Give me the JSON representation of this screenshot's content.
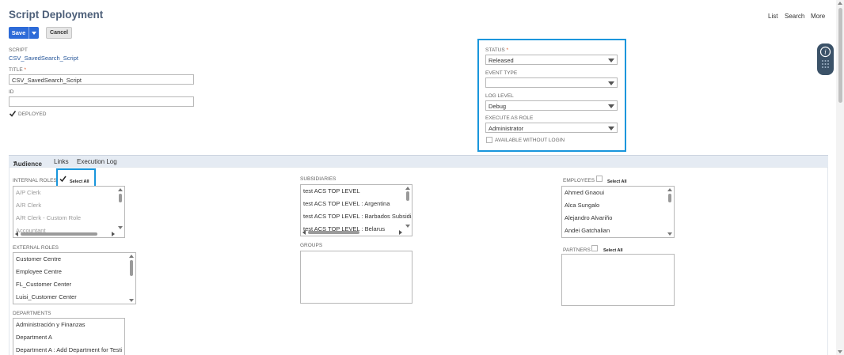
{
  "header": {
    "title": "Script Deployment"
  },
  "top_nav": [
    "List",
    "Search",
    "More"
  ],
  "toolbar": {
    "save_label": "Save",
    "cancel_label": "Cancel"
  },
  "primary": {
    "script_label": "SCRIPT",
    "script_value": "CSV_SavedSearch_Script",
    "title_label": "TITLE",
    "title_value": "CSV_SavedSearch_Script",
    "id_label": "ID",
    "id_value": "",
    "deployed_label": "DEPLOYED",
    "deployed_checked": true
  },
  "settings": {
    "status_label": "STATUS",
    "status_value": "Released",
    "event_type_label": "EVENT TYPE",
    "event_type_value": "",
    "log_level_label": "LOG LEVEL",
    "log_level_value": "Debug",
    "execute_as_role_label": "EXECUTE AS ROLE",
    "execute_as_role_value": "Administrator",
    "available_without_login_label": "AVAILABLE WITHOUT LOGIN"
  },
  "tabs": [
    {
      "label": "Audience",
      "marker": "•"
    },
    {
      "label": "Links"
    },
    {
      "label": "Execution Log"
    }
  ],
  "audience": {
    "select_all_label": "Select All",
    "internal_roles_label": "INTERNAL ROLES",
    "internal_roles": [
      "A/P Clerk",
      "A/R Clerk",
      "A/R Clerk - Custom Role",
      "Accountant"
    ],
    "external_roles_label": "EXTERNAL ROLES",
    "external_roles": [
      "Customer Centre",
      "Employee Centre",
      "FL_Customer Center",
      "Luisi_Customer Center"
    ],
    "departments_label": "DEPARTMENTS",
    "departments": [
      "Administración y Finanzas",
      "Department A",
      "Department A : Add Department for Testi"
    ],
    "subsidiaries_label": "SUBSIDIARIES",
    "subsidiaries": [
      "test ACS TOP LEVEL",
      "test ACS TOP LEVEL : Argentina",
      "test ACS TOP LEVEL : Barbados Subsidia",
      "test ACS TOP LEVEL : Belarus"
    ],
    "groups_label": "GROUPS",
    "employees_label": "EMPLOYEES",
    "employees": [
      "Ahmed Gnaoui",
      "Alca Sungalo",
      "Alejandro Alvariño",
      "Andei Gatchalian"
    ],
    "partners_label": "PARTNERS"
  },
  "help_widget": {
    "icon": "info-icon"
  }
}
